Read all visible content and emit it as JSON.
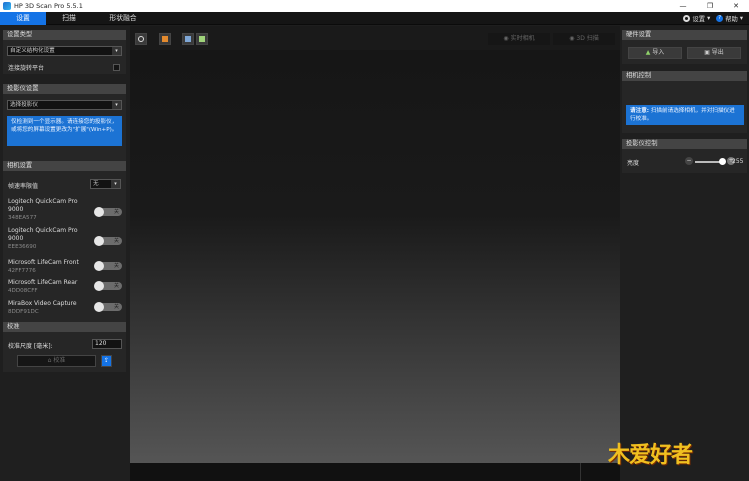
{
  "window": {
    "title": "HP 3D Scan Pro 5.5.1"
  },
  "menu": {
    "tabs": [
      {
        "label": "设置"
      },
      {
        "label": "扫描"
      },
      {
        "label": "形状融合"
      }
    ],
    "settings_label": "设置",
    "help_label": "帮助",
    "accent": "#1473e6"
  },
  "left": {
    "setup_type": {
      "header": "设置类型",
      "selected": "自定义结构化设置",
      "turntable_label": "连接旋转平台"
    },
    "projector_settings": {
      "header": "投影仪设置",
      "selected": "选择投影仪",
      "info": "仅检测到一个显示器。请连接您的投影仪，或将您的屏幕设置更改为\"扩展\"(Win+P)。"
    },
    "camera_settings": {
      "header": "相机设置",
      "fps_label": "帧速率限值",
      "fps_value": "无",
      "cameras": [
        {
          "name": "Logitech QuickCam Pro 9000",
          "id": "348EA577",
          "state": "关"
        },
        {
          "name": "Logitech QuickCam Pro 9000",
          "id": "EEE36690",
          "state": "关"
        },
        {
          "name": "Microsoft LifeCam Front",
          "id": "42FF7776",
          "state": "关"
        },
        {
          "name": "Microsoft LifeCam Rear",
          "id": "4DD08CFF",
          "state": "关"
        },
        {
          "name": "MiraBox Video Capture",
          "id": "8DDF91DC",
          "state": "关"
        }
      ]
    },
    "calibration": {
      "header": "校准",
      "size_label": "校准尺度 [毫米]:",
      "size_value": "120",
      "button_label": "校准"
    }
  },
  "center": {
    "mode_live": "实时相机",
    "mode_3d": "3D 扫描"
  },
  "right": {
    "hardware": {
      "header": "硬件设置",
      "import_label": "导入",
      "export_label": "导出"
    },
    "camera_control": {
      "header": "相机控制",
      "note_bold": "请注意:",
      "note_text": "扫描前请选择相机，并对扫描仪进行校准。"
    },
    "projector_control": {
      "header": "投影仪控制",
      "brightness_label": "亮度",
      "brightness_value": "255",
      "brightness_fraction": 0.93
    }
  }
}
